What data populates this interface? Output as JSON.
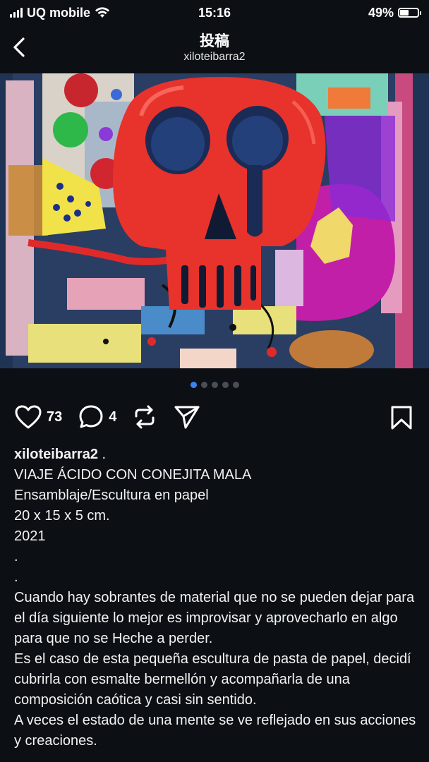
{
  "status_bar": {
    "carrier": "UQ mobile",
    "time": "15:16",
    "battery_percent": "49%",
    "battery_level": 0.49
  },
  "header": {
    "title": "投稿",
    "subtitle": "xiloteibarra2"
  },
  "carousel": {
    "total": 5,
    "active_index": 0
  },
  "actions": {
    "likes": "73",
    "comments": "4"
  },
  "caption": {
    "username": "xiloteibarra2",
    "username_suffix": " .",
    "line1": "VIAJE ÁCIDO CON CONEJITA MALA",
    "line2": "Ensamblaje/Escultura en papel",
    "line3": "20 x 15 x 5 cm.",
    "line4": "2021",
    "line5": ".",
    "line6": ".",
    "para1": "Cuando hay sobrantes de material que no se pueden dejar para el día siguiente lo mejor es improvisar y aprovecharlo en algo para que no se Heche a perder.",
    "para2": "Es el caso de esta pequeña escultura de pasta de papel, decidí cubrirla con esmalte bermellón y acompañarla de una composición caótica y casi sin sentido.",
    "para3": "A veces el estado de una mente se ve reflejado en sus acciones y creaciones."
  },
  "colors": {
    "background": "#0c1014",
    "skull_red": "#e8322c",
    "accent_blue": "#3b82f6",
    "magenta": "#c21fa8"
  }
}
